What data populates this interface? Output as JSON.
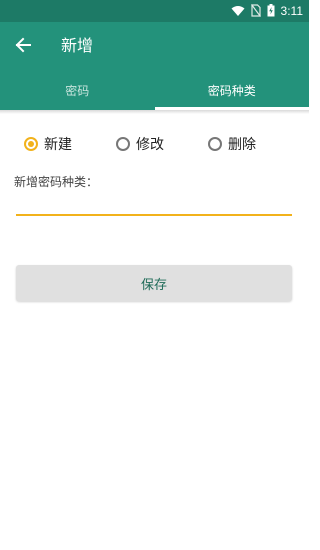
{
  "status_bar": {
    "time": "3:11",
    "icons": [
      "wifi-icon",
      "no-sim-icon",
      "battery-charging-icon"
    ]
  },
  "app_bar": {
    "back_icon": "arrow-left-icon",
    "title": "新增"
  },
  "tabs": [
    {
      "label": "密码",
      "active": false
    },
    {
      "label": "密码种类",
      "active": true
    }
  ],
  "form": {
    "radio_options": [
      {
        "label": "新建",
        "checked": true
      },
      {
        "label": "修改",
        "checked": false
      },
      {
        "label": "删除",
        "checked": false
      }
    ],
    "field_label": "新增密码种类：",
    "input_value": "",
    "save_label": "保存"
  },
  "colors": {
    "primary": "#23927b",
    "primary_dark": "#1d7a66",
    "accent": "#f2b21b",
    "button_bg": "#e0e0e0",
    "button_text": "#1f6b58"
  }
}
